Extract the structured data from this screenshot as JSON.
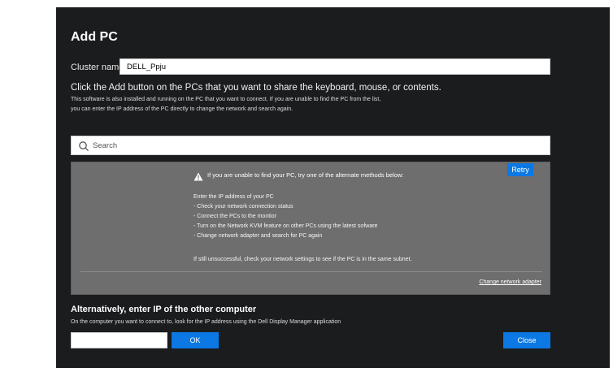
{
  "dialog": {
    "title": "Add PC",
    "cluster_label": "Cluster name",
    "cluster_value": "DELL_Ppju",
    "instruction": "Click the Add button on the PCs that you want to share the keyboard, mouse, or contents.",
    "sub_line1": "This software is also installed and running on the PC that you want to connect. If you are unable to find the PC from the list,",
    "sub_line2": "you can enter the IP address of the PC directly to change the network and search again.",
    "search": {
      "placeholder": "Search",
      "icon": "search-icon"
    }
  },
  "panel": {
    "retry_label": "Retry",
    "warning_icon": "warning-icon",
    "warning_text": "If you are unable to find your PC, try one of the alternate methods below:",
    "lines": [
      "Enter the IP address of your PC",
      "- Check your network connection status",
      "- Connect the PCs to the montior",
      "- Turn on the Network KVM feature on other PCs using the latest sofware",
      "- Change network adapter and search for PC again"
    ],
    "footer": "If still unsuccessful, check your network settings to see if the PC is in the same subnet.",
    "change_link": "Change network adapter"
  },
  "alternative": {
    "heading": "Alternatively, enter IP of the other computer",
    "sub": "On the computer you want to connect to, look for the IP address using the Dell Display Manager application",
    "ip_value": "",
    "ok_label": "OK",
    "close_label": "Close"
  },
  "colors": {
    "background": "#1b1c1e",
    "panel": "#6e6e6e",
    "accent": "#0b78e3"
  }
}
